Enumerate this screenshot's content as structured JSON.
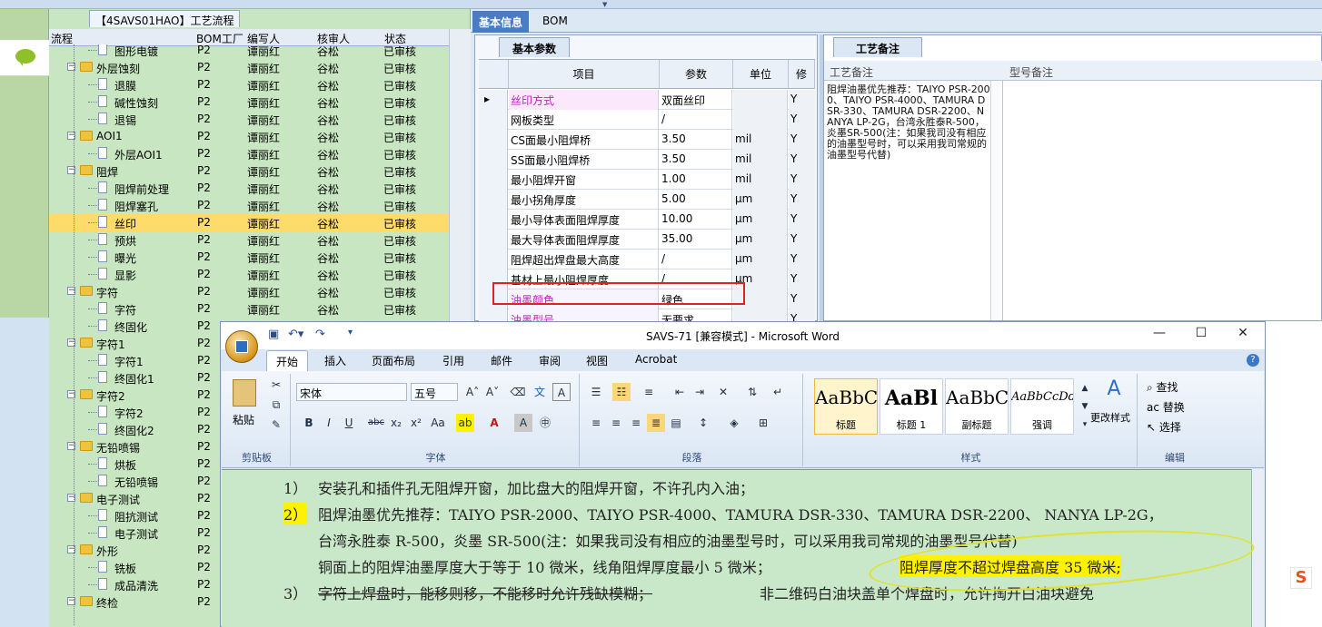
{
  "tree": {
    "title": "【4SAVS01HAO】工艺流程",
    "headers": [
      "流程",
      "BOM工厂",
      "编写人",
      "核审人",
      "状态"
    ],
    "rows": [
      {
        "name": "图形电镀",
        "kind": "doc",
        "level": 2,
        "factory": "P2",
        "writer": "谭丽红",
        "reviewer": "谷松",
        "status": "已审核"
      },
      {
        "name": "外层蚀刻",
        "kind": "folder",
        "level": 1,
        "factory": "P2",
        "writer": "谭丽红",
        "reviewer": "谷松",
        "status": "已审核"
      },
      {
        "name": "退膜",
        "kind": "doc",
        "level": 2,
        "factory": "P2",
        "writer": "谭丽红",
        "reviewer": "谷松",
        "status": "已审核"
      },
      {
        "name": "碱性蚀刻",
        "kind": "doc",
        "level": 2,
        "factory": "P2",
        "writer": "谭丽红",
        "reviewer": "谷松",
        "status": "已审核"
      },
      {
        "name": "退锡",
        "kind": "doc",
        "level": 2,
        "factory": "P2",
        "writer": "谭丽红",
        "reviewer": "谷松",
        "status": "已审核"
      },
      {
        "name": "AOI1",
        "kind": "folder",
        "level": 1,
        "factory": "P2",
        "writer": "谭丽红",
        "reviewer": "谷松",
        "status": "已审核"
      },
      {
        "name": "外层AOI1",
        "kind": "doc",
        "level": 2,
        "factory": "P2",
        "writer": "谭丽红",
        "reviewer": "谷松",
        "status": "已审核"
      },
      {
        "name": "阻焊",
        "kind": "folder",
        "level": 1,
        "factory": "P2",
        "writer": "谭丽红",
        "reviewer": "谷松",
        "status": "已审核"
      },
      {
        "name": "阻焊前处理",
        "kind": "doc",
        "level": 2,
        "factory": "P2",
        "writer": "谭丽红",
        "reviewer": "谷松",
        "status": "已审核"
      },
      {
        "name": "阻焊塞孔",
        "kind": "doc",
        "level": 2,
        "factory": "P2",
        "writer": "谭丽红",
        "reviewer": "谷松",
        "status": "已审核"
      },
      {
        "name": "丝印",
        "kind": "doc",
        "level": 2,
        "factory": "P2",
        "writer": "谭丽红",
        "reviewer": "谷松",
        "status": "已审核",
        "selected": true
      },
      {
        "name": "预烘",
        "kind": "doc",
        "level": 2,
        "factory": "P2",
        "writer": "谭丽红",
        "reviewer": "谷松",
        "status": "已审核"
      },
      {
        "name": "曝光",
        "kind": "doc",
        "level": 2,
        "factory": "P2",
        "writer": "谭丽红",
        "reviewer": "谷松",
        "status": "已审核"
      },
      {
        "name": "显影",
        "kind": "doc",
        "level": 2,
        "factory": "P2",
        "writer": "谭丽红",
        "reviewer": "谷松",
        "status": "已审核"
      },
      {
        "name": "字符",
        "kind": "folder",
        "level": 1,
        "factory": "P2",
        "writer": "谭丽红",
        "reviewer": "谷松",
        "status": "已审核"
      },
      {
        "name": "字符",
        "kind": "doc",
        "level": 2,
        "factory": "P2",
        "writer": "谭丽红",
        "reviewer": "谷松",
        "status": "已审核"
      },
      {
        "name": "终固化",
        "kind": "doc",
        "level": 2,
        "factory": "P2",
        "writer": "",
        "reviewer": "",
        "status": ""
      },
      {
        "name": "字符1",
        "kind": "folder",
        "level": 1,
        "factory": "P2",
        "writer": "",
        "reviewer": "",
        "status": ""
      },
      {
        "name": "字符1",
        "kind": "doc",
        "level": 2,
        "factory": "P2",
        "writer": "",
        "reviewer": "",
        "status": ""
      },
      {
        "name": "终固化1",
        "kind": "doc",
        "level": 2,
        "factory": "P2",
        "writer": "",
        "reviewer": "",
        "status": ""
      },
      {
        "name": "字符2",
        "kind": "folder",
        "level": 1,
        "factory": "P2",
        "writer": "",
        "reviewer": "",
        "status": ""
      },
      {
        "name": "字符2",
        "kind": "doc",
        "level": 2,
        "factory": "P2",
        "writer": "",
        "reviewer": "",
        "status": ""
      },
      {
        "name": "终固化2",
        "kind": "doc",
        "level": 2,
        "factory": "P2",
        "writer": "",
        "reviewer": "",
        "status": ""
      },
      {
        "name": "无铅喷锡",
        "kind": "folder",
        "level": 1,
        "factory": "P2",
        "writer": "",
        "reviewer": "",
        "status": ""
      },
      {
        "name": "烘板",
        "kind": "doc",
        "level": 2,
        "factory": "P2",
        "writer": "",
        "reviewer": "",
        "status": ""
      },
      {
        "name": "无铅喷锡",
        "kind": "doc",
        "level": 2,
        "factory": "P2",
        "writer": "",
        "reviewer": "",
        "status": ""
      },
      {
        "name": "电子测试",
        "kind": "folder",
        "level": 1,
        "factory": "P2",
        "writer": "",
        "reviewer": "",
        "status": ""
      },
      {
        "name": "阻抗测试",
        "kind": "doc",
        "level": 2,
        "factory": "P2",
        "writer": "",
        "reviewer": "",
        "status": ""
      },
      {
        "name": "电子测试",
        "kind": "doc",
        "level": 2,
        "factory": "P2",
        "writer": "",
        "reviewer": "",
        "status": ""
      },
      {
        "name": "外形",
        "kind": "folder",
        "level": 1,
        "factory": "P2",
        "writer": "",
        "reviewer": "",
        "status": ""
      },
      {
        "name": "铣板",
        "kind": "doc",
        "level": 2,
        "factory": "P2",
        "writer": "",
        "reviewer": "",
        "status": ""
      },
      {
        "name": "成品清洗",
        "kind": "doc",
        "level": 2,
        "factory": "P2",
        "writer": "",
        "reviewer": "",
        "status": ""
      },
      {
        "name": "终检",
        "kind": "folder",
        "level": 1,
        "factory": "P2",
        "writer": "",
        "reviewer": "",
        "status": ""
      }
    ]
  },
  "right": {
    "tabs": [
      "基本信息",
      "BOM"
    ],
    "params_tab": "基本参数",
    "grid_headers": [
      "项目",
      "参数",
      "单位",
      "修"
    ],
    "rows": [
      {
        "item": "丝印方式",
        "value": "双面丝印",
        "unit": "",
        "flag": "Y",
        "style": "pink",
        "current": true
      },
      {
        "item": "网板类型",
        "value": "/",
        "unit": "",
        "flag": "Y"
      },
      {
        "item": "CS面最小阻焊桥",
        "value": "3.50",
        "unit": "mil",
        "flag": "Y"
      },
      {
        "item": "SS面最小阻焊桥",
        "value": "3.50",
        "unit": "mil",
        "flag": "Y"
      },
      {
        "item": "最小阻焊开窗",
        "value": "1.00",
        "unit": "mil",
        "flag": "Y"
      },
      {
        "item": "最小拐角厚度",
        "value": "5.00",
        "unit": "μm",
        "flag": "Y"
      },
      {
        "item": "最小导体表面阻焊厚度",
        "value": "10.00",
        "unit": "μm",
        "flag": "Y"
      },
      {
        "item": "最大导体表面阻焊厚度",
        "value": "35.00",
        "unit": "μm",
        "flag": "Y"
      },
      {
        "item": "阻焊超出焊盘最大高度",
        "value": "/",
        "unit": "μm",
        "flag": "Y"
      },
      {
        "item": "基材上最小阻焊厚度",
        "value": "/",
        "unit": "μm",
        "flag": "Y"
      },
      {
        "item": "油墨颜色",
        "value": "绿色",
        "unit": "",
        "flag": "Y",
        "style": "pink"
      },
      {
        "item": "油墨型号",
        "value": "无要求",
        "unit": "",
        "flag": "Y",
        "style": "pink"
      }
    ],
    "remarks_tab": "工艺备注",
    "remarks_headers": [
      "工艺备注",
      "型号备注"
    ],
    "remarks_text": "阻焊油墨优先推荐：TAIYO PSR-2000、TAIYO PSR-4000、TAMURA DSR-330、TAMURA DSR-2200、NANYA LP-2G，台湾永胜泰R-500，炎墨SR-500(注：如果我司没有相应的油墨型号时，可以采用我司常规的油墨型号代替)"
  },
  "word": {
    "title": "SAVS-71 [兼容模式] - Microsoft Word",
    "tabs": [
      "开始",
      "插入",
      "页面布局",
      "引用",
      "邮件",
      "审阅",
      "视图",
      "Acrobat"
    ],
    "font_name": "宋体",
    "font_size": "五号",
    "groups": {
      "clipboard": "剪贴板",
      "font": "字体",
      "paragraph": "段落",
      "styles": "样式",
      "editing": "编辑"
    },
    "paste_label": "粘贴",
    "styles": [
      {
        "preview": "AaBbC",
        "name": "标题"
      },
      {
        "preview": "AaBl",
        "name": "标题 1"
      },
      {
        "preview": "AaBbC",
        "name": "副标题"
      },
      {
        "preview": "AaBbCcDd",
        "name": "强调"
      }
    ],
    "change_styles": "更改样式",
    "edit_find": "查找",
    "edit_replace": "替换",
    "edit_select": "选择",
    "doc": {
      "l1_num": "1）",
      "l1_text": "安装孔和插件孔无阻焊开窗，加比盘大的阻焊开窗，不许孔内入油；",
      "l2_num": "2）",
      "l2_text": "阻焊油墨优先推荐：TAIYO PSR-2000、TAIYO PSR-4000、TAMURA  DSR-330、TAMURA DSR-2200、 NANYA LP-2G，",
      "l3_text": "台湾永胜泰 R-500，炎墨 SR-500(注：如果我司没有相应的油墨型号时，可以采用我司常规的油墨型号代替)",
      "l4_text_a": "铜面上的阻焊油墨厚度大于等于 10 微米，线角阻焊厚度最小 5 微米；",
      "l4_text_b": "阻焊厚度不超过焊盘高度 35 微米;",
      "l5_num": "3）",
      "l5_text_a": "字符上焊盘时，能移则移，不能移时允许残缺模糊；",
      "l5_text_b": "非二维码白油块盖单个焊盘时，允许掏开白油块避免"
    }
  },
  "colors": {
    "selection": "#ffdc6a",
    "highlight": "#fff200",
    "annotation_red": "#e12222",
    "annotation_yellow": "#e2e12b",
    "tree_bg": "#c8e6c1",
    "doc_bg": "#c9e8c9"
  }
}
